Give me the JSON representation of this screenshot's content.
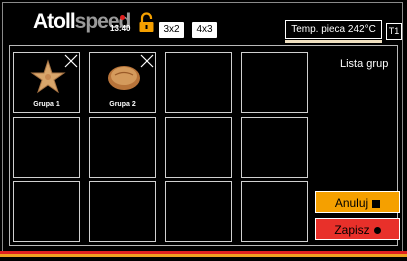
{
  "header": {
    "logo_left": "Atoll",
    "logo_right": "speed",
    "time": "13:40",
    "layout_3x2": "3x2",
    "layout_4x3": "4x3",
    "temperature": "Temp. pieca 242°C",
    "tab": "T1"
  },
  "groups_title": "Lista grup",
  "tiles": [
    {
      "label": "Grupa 1",
      "image": "starfish-cookie"
    },
    {
      "label": "Grupa 2",
      "image": "bread-roll"
    }
  ],
  "buttons": {
    "cancel": "Anuluj",
    "save": "Zapisz"
  },
  "colors": {
    "cancel_bg": "#f5a000",
    "save_bg": "#e8302a",
    "stripe_red": "#e02020",
    "stripe_orange": "#f0a020"
  }
}
